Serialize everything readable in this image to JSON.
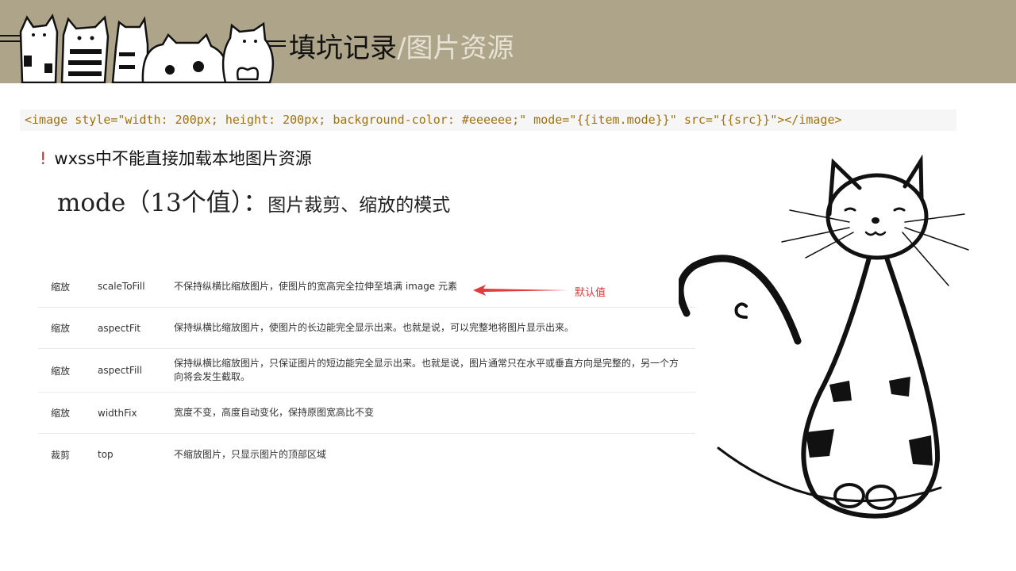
{
  "title": {
    "main": "填坑记录",
    "sub": "/图片资源"
  },
  "code_line": "<image style=\"width: 200px; height: 200px; background-color: #eeeeee;\" mode=\"{{item.mode}}\" src=\"{{src}}\"></image>",
  "note": {
    "mark": "!",
    "text": "wxss中不能直接加载本地图片资源"
  },
  "mode_heading": {
    "big": "mode（13个值）：",
    "small": "图片裁剪、缩放的模式"
  },
  "table": {
    "rows": [
      {
        "type": "缩放",
        "mode": "scaleToFill",
        "desc": "不保持纵横比缩放图片，使图片的宽高完全拉伸至填满 image 元素"
      },
      {
        "type": "缩放",
        "mode": "aspectFit",
        "desc": "保持纵横比缩放图片，使图片的长边能完全显示出来。也就是说，可以完整地将图片显示出来。"
      },
      {
        "type": "缩放",
        "mode": "aspectFill",
        "desc": "保持纵横比缩放图片，只保证图片的短边能完全显示出来。也就是说，图片通常只在水平或垂直方向是完整的，另一个方向将会发生截取。"
      },
      {
        "type": "缩放",
        "mode": "widthFix",
        "desc": "宽度不变，高度自动变化，保持原图宽高比不变"
      },
      {
        "type": "裁剪",
        "mode": "top",
        "desc": "不缩放图片，只显示图片的顶部区域"
      }
    ]
  },
  "annotation": {
    "label": "默认值",
    "color": "#e03a3a"
  },
  "colors": {
    "header_bg": "#ada48a",
    "code_text": "#a0720e",
    "code_bg": "#f6f6f6"
  },
  "decorations": {
    "header_art": "cartoon-cats-icon",
    "side_art": "sketch-cat-icon"
  }
}
